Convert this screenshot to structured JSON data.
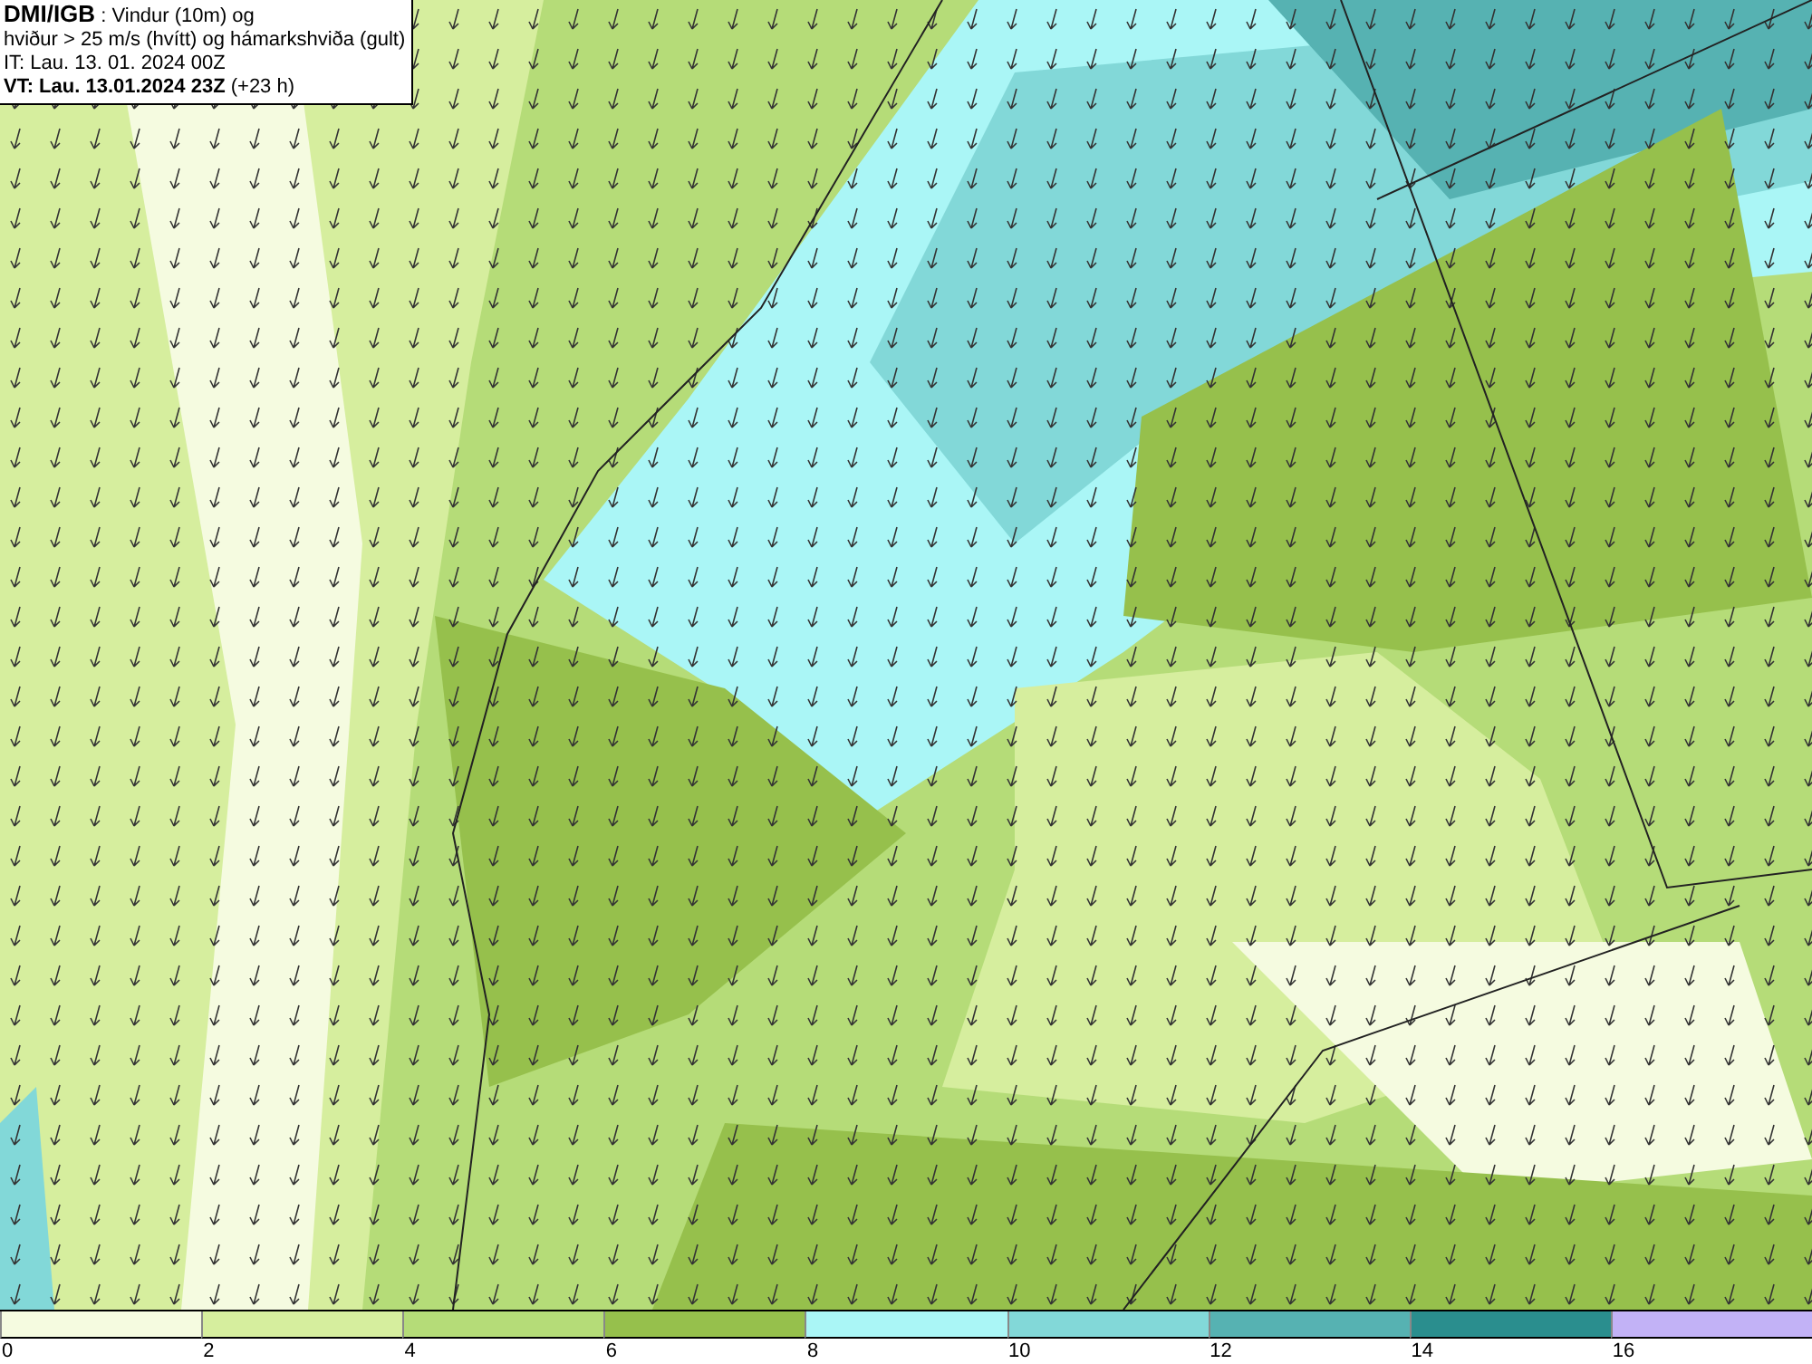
{
  "info_box": {
    "lines": [
      "**DMI/IGB** : Vindur (10m) og",
      "hviður > 25 m/s (hvítt) og hámarkshviða (gult)",
      "IT: Lau. 13. 01. 2024 00Z",
      "**VT: Lau. 13.01.2024 23Z** (+23 h)"
    ]
  },
  "legend": {
    "bins": [
      {
        "label": "0",
        "color": "#f5fbe0"
      },
      {
        "label": "2",
        "color": "#d6ee9e"
      },
      {
        "label": "4",
        "color": "#b5dc78"
      },
      {
        "label": "6",
        "color": "#96c04c"
      },
      {
        "label": "8",
        "color": "#aaf6f6"
      },
      {
        "label": "10",
        "color": "#82d8d8"
      },
      {
        "label": "12",
        "color": "#56b2b2"
      },
      {
        "label": "14",
        "color": "#2a8e8e"
      },
      {
        "label": "16",
        "color": "#c2b2f6"
      }
    ]
  }
}
